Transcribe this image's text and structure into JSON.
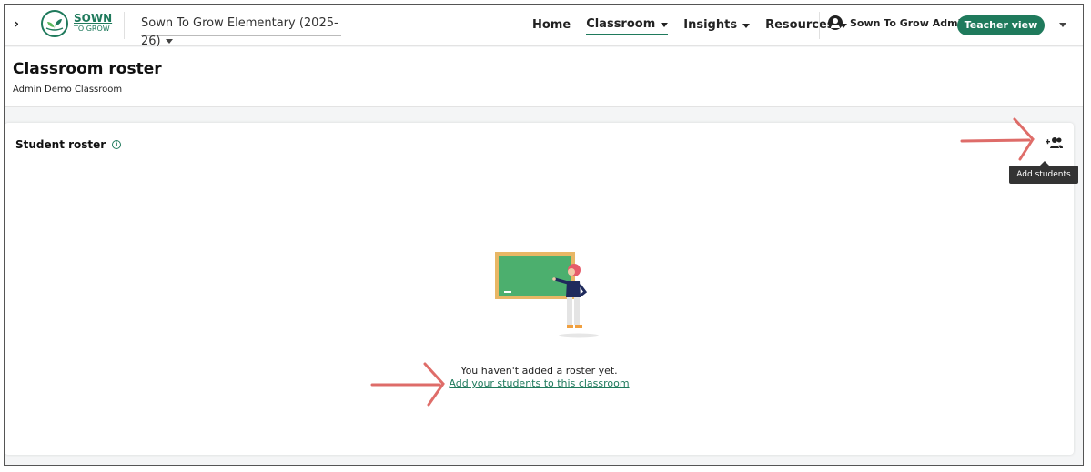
{
  "nav": {
    "logo_line1": "SOWN",
    "logo_line2": "TO GROW",
    "school": "Sown To Grow Elementary (2025-26)",
    "links": [
      "Home",
      "Classroom",
      "Insights",
      "Resources"
    ],
    "user_name": "Sown To Grow Admin",
    "view_button": "Teacher view"
  },
  "header": {
    "title": "Classroom roster",
    "subtitle": "Admin Demo Classroom"
  },
  "roster": {
    "title": "Student roster",
    "tooltip": "Add students",
    "empty_message": "You haven't added a roster yet.",
    "empty_link": "Add your students to this classroom"
  },
  "colors": {
    "brand": "#1f7a5c",
    "annotation_arrow": "#d9534f"
  },
  "icons": {
    "expand": "chevron-right-icon",
    "user": "account-circle-icon",
    "info": "info-icon",
    "add_students": "add-group-icon"
  }
}
